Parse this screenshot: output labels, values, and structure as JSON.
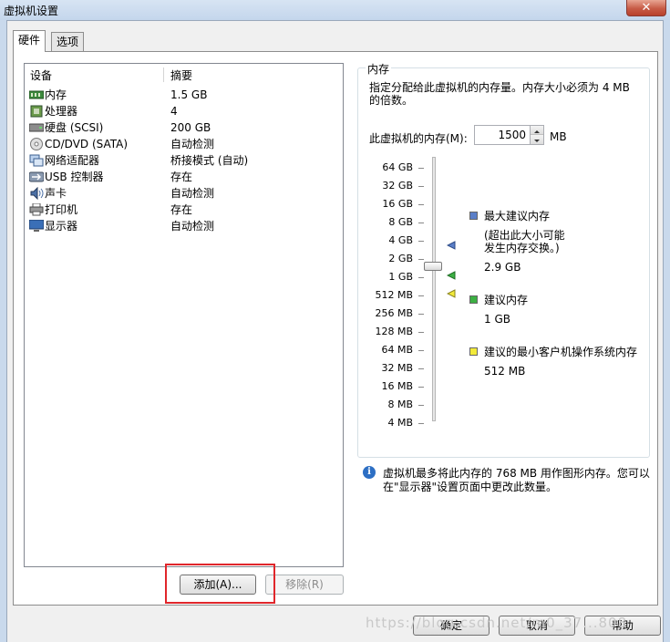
{
  "window": {
    "title": "虚拟机设置",
    "close_glyph": "✕"
  },
  "tabs": [
    {
      "label": "硬件"
    },
    {
      "label": "选项"
    }
  ],
  "device_list": {
    "col_device": "设备",
    "col_summary": "摘要",
    "rows": [
      {
        "name": "内存",
        "summary": "1.5 GB",
        "icon": "memory-icon"
      },
      {
        "name": "处理器",
        "summary": "4",
        "icon": "processor-icon"
      },
      {
        "name": "硬盘 (SCSI)",
        "summary": "200 GB",
        "icon": "hard-disk-icon"
      },
      {
        "name": "CD/DVD (SATA)",
        "summary": "自动检测",
        "icon": "cd-dvd-icon"
      },
      {
        "name": "网络适配器",
        "summary": "桥接模式 (自动)",
        "icon": "network-adapter-icon"
      },
      {
        "name": "USB 控制器",
        "summary": "存在",
        "icon": "usb-icon"
      },
      {
        "name": "声卡",
        "summary": "自动检测",
        "icon": "sound-card-icon"
      },
      {
        "name": "打印机",
        "summary": "存在",
        "icon": "printer-icon"
      },
      {
        "name": "显示器",
        "summary": "自动检测",
        "icon": "display-icon"
      }
    ]
  },
  "buttons": {
    "add": "添加(A)...",
    "remove": "移除(R)",
    "ok": "确定",
    "cancel": "取消",
    "help": "帮助"
  },
  "memory": {
    "group_title": "内存",
    "description": "指定分配给此虚拟机的内存量。内存大小必须为 4 MB 的倍数。",
    "label": "此虚拟机的内存(M):",
    "value": "1500",
    "unit": "MB",
    "scale": [
      "64 GB",
      "32 GB",
      "16 GB",
      "8 GB",
      "4 GB",
      "2 GB",
      "1 GB",
      "512 MB",
      "256 MB",
      "128 MB",
      "64 MB",
      "32 MB",
      "16 MB",
      "8 MB",
      "4 MB"
    ],
    "legend": {
      "max_title": "最大建议内存",
      "max_note_1": "(超出此大小可能",
      "max_note_2": "发生内存交换。)",
      "max_value": "2.9 GB",
      "rec_title": "建议内存",
      "rec_value": "1 GB",
      "min_title": "建议的最小客户机操作系统内存",
      "min_value": "512 MB"
    },
    "colors": {
      "max": "#5b7fc8",
      "rec": "#3cb043",
      "min": "#f2ea3a"
    }
  },
  "info": {
    "line1": "虚拟机最多将此内存的 768 MB 用作图形内存。您可以",
    "line2": "在\"显示器\"设置页面中更改此数量。"
  },
  "watermark": "https://blog.csdn.net/m0_37...808"
}
